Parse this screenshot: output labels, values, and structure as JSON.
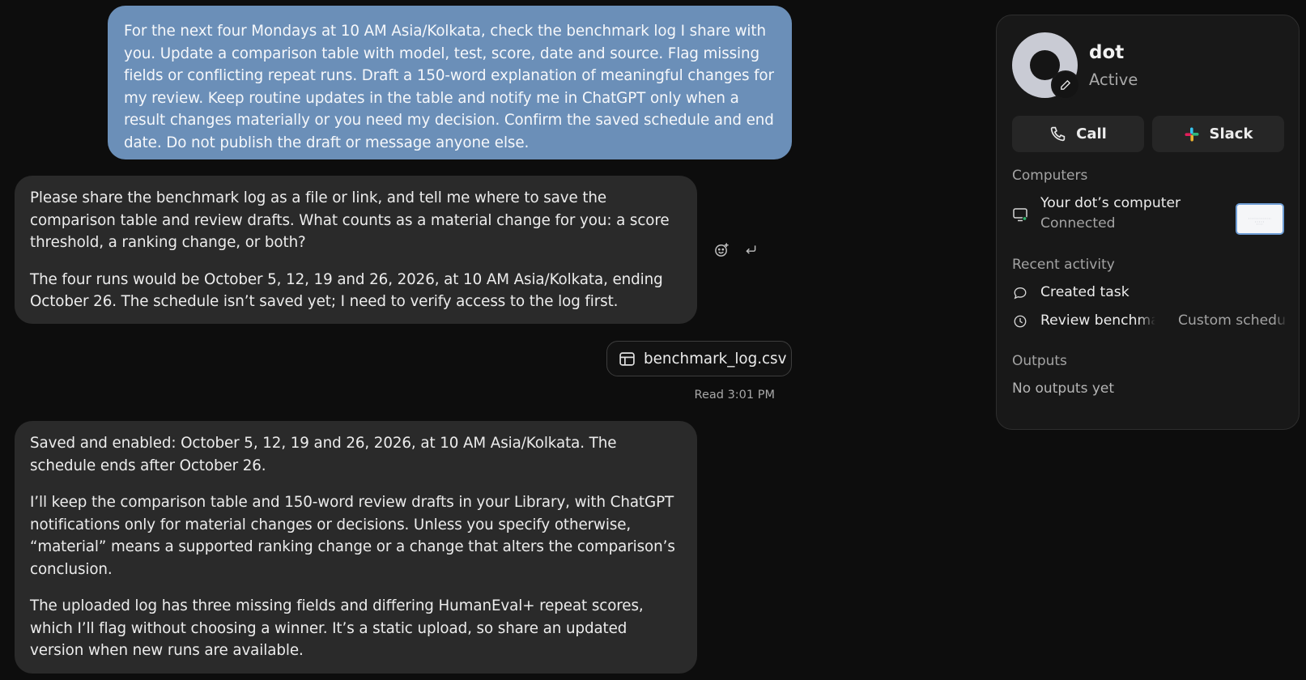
{
  "chat": {
    "user_message": "For the next four Mondays at 10 AM Asia/Kolkata, check the benchmark log I share with you. Update a comparison table with model, test, score, date and source. Flag missing fields or conflicting repeat runs. Draft a 150-word explanation of meaningful changes for my review. Keep routine updates in the table and notify me in ChatGPT only when a result changes materially or you need my decision. Confirm the saved schedule and end date. Do not publish the draft or message anyone else.",
    "assistant_reply_1": [
      "Please share the benchmark log as a file or link, and tell me where to save the comparison table and review drafts. What counts as a material change for you: a score threshold, a ranking change, or both?",
      "The four runs would be October 5, 12, 19 and 26, 2026, at 10 AM Asia/Kolkata, ending October 26. The schedule isn’t saved yet; I need to verify access to the log first."
    ],
    "attachment": {
      "file_name": "benchmark_log.csv",
      "icon": "table-icon"
    },
    "read_receipt": "Read 3:01 PM",
    "assistant_reply_2": [
      "Saved and enabled: October 5, 12, 19 and 26, 2026, at 10 AM Asia/Kolkata. The schedule ends after October 26.",
      "I’ll keep the comparison table and 150-word review drafts in your Library, with ChatGPT notifications only for material changes or decisions. Unless you specify otherwise, “material” means a supported ranking change or a change that alters the comparison’s conclusion.",
      "The uploaded log has three missing fields and differing HumanEval+ repeat scores, which I’ll flag without choosing a winner. It’s a static upload, so share an updated version when new runs are available."
    ],
    "message_actions": [
      "add-reaction-icon",
      "reply-icon"
    ]
  },
  "panel": {
    "agent_name": "dot",
    "agent_status": "Active",
    "call_label": "Call",
    "slack_label": "Slack",
    "computers_heading": "Computers",
    "computer_name": "Your dot’s computer",
    "computer_status": "Connected",
    "recent_heading": "Recent activity",
    "recent": [
      {
        "label": "Created task",
        "meta": "",
        "icon": "chat-bubble-icon"
      },
      {
        "label": "Review benchmark c",
        "meta": "Custom schedule",
        "icon": "clock-icon"
      }
    ],
    "outputs_heading": "Outputs",
    "outputs_empty": "No outputs yet"
  },
  "colors": {
    "background": "#0d0d0d",
    "user_bubble": "#6b8fb8",
    "assistant_bubble": "#2a2a2a",
    "panel": "#181818",
    "connected_dot": "#2fb36b"
  }
}
